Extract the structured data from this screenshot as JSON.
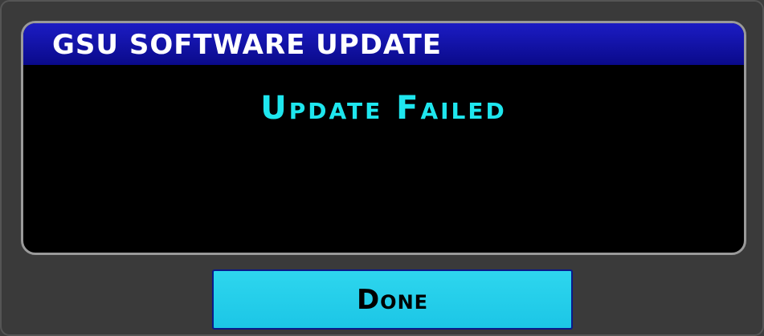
{
  "dialog": {
    "title": "GSU SOFTWARE UPDATE",
    "status": "Update Failed",
    "done_label": "Done"
  },
  "colors": {
    "background": "#3a3a3a",
    "panel": "#000000",
    "titlebar": "#1414b0",
    "status_text": "#1ee6ee",
    "button": "#2ad2ec"
  }
}
